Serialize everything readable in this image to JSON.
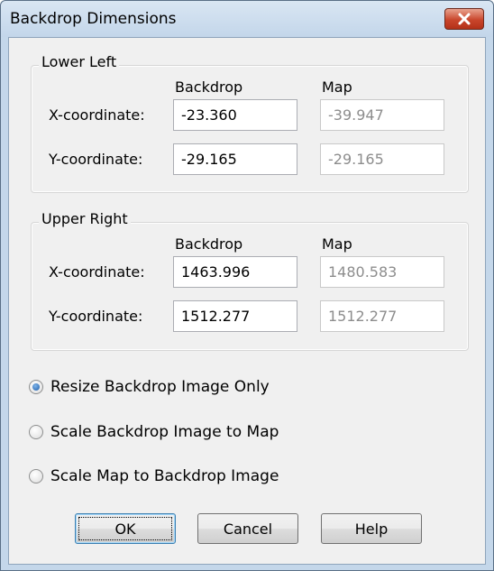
{
  "window": {
    "title": "Backdrop Dimensions"
  },
  "lower_left": {
    "label": "Lower Left",
    "col_backdrop": "Backdrop",
    "col_map": "Map",
    "x_label": "X-coordinate:",
    "y_label": "Y-coordinate:",
    "x_backdrop": "-23.360",
    "x_map": "-39.947",
    "y_backdrop": "-29.165",
    "y_map": "-29.165"
  },
  "upper_right": {
    "label": "Upper Right",
    "col_backdrop": "Backdrop",
    "col_map": "Map",
    "x_label": "X-coordinate:",
    "y_label": "Y-coordinate:",
    "x_backdrop": "1463.996",
    "x_map": "1480.583",
    "y_backdrop": "1512.277",
    "y_map": "1512.277"
  },
  "options": [
    {
      "label": "Resize Backdrop Image Only",
      "selected": true
    },
    {
      "label": "Scale Backdrop Image to Map",
      "selected": false
    },
    {
      "label": "Scale Map to Backdrop Image",
      "selected": false
    }
  ],
  "buttons": {
    "ok": "OK",
    "cancel": "Cancel",
    "help": "Help"
  },
  "icons": {
    "close": "close-icon"
  },
  "colors": {
    "title_bar": "#c4d7ea",
    "close_button": "#c9462c"
  }
}
